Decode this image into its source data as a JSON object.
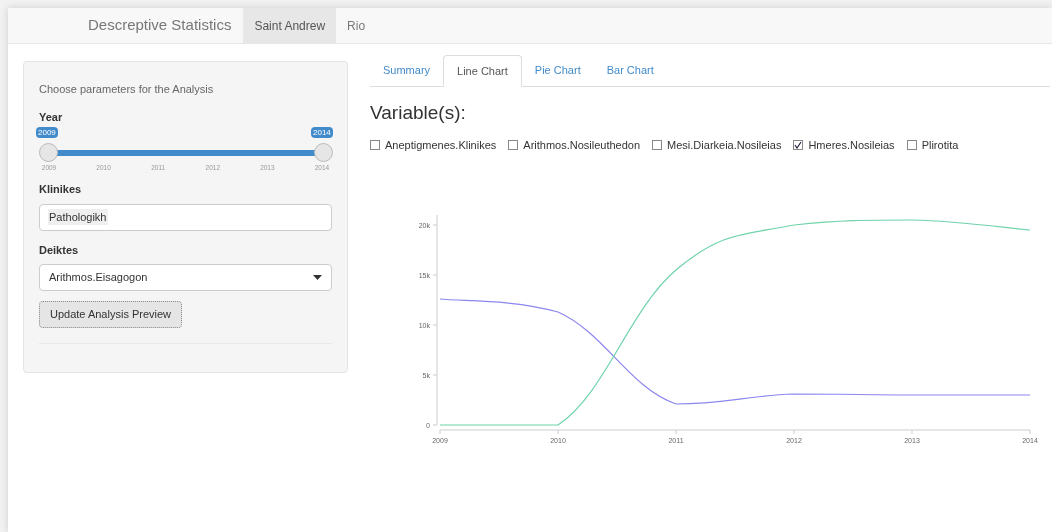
{
  "navbar": {
    "brand": "Descreptive Statistics",
    "tabs": [
      {
        "label": "Saint Andrew",
        "selected": true
      },
      {
        "label": "Rio",
        "selected": false
      }
    ]
  },
  "sidebar": {
    "heading": "Choose parameters for the Analysis",
    "year": {
      "label": "Year",
      "handles": [
        {
          "label": "2009",
          "level": 0
        },
        {
          "label": "2014",
          "level": 1
        }
      ],
      "ticks": [
        "2009",
        "2010",
        "2011",
        "2012",
        "2013",
        "2014"
      ]
    },
    "klinikes": {
      "label": "Klinikes",
      "tags": [
        "Pathologikh"
      ]
    },
    "deiktes": {
      "label": "Deiktes",
      "value": "Arithmos.Eisagogon"
    },
    "button": "Update Analysis Preview"
  },
  "main": {
    "tabs": [
      {
        "label": "Summary",
        "selected": false
      },
      {
        "label": "Line Chart",
        "selected": true
      },
      {
        "label": "Pie Chart",
        "selected": false
      },
      {
        "label": "Bar Chart",
        "selected": false
      }
    ],
    "heading": "Variable(s):",
    "variables": [
      {
        "label": "Aneptigmenes.Klinikes",
        "checked": false
      },
      {
        "label": "Arithmos.Nosileuthedon",
        "checked": false
      },
      {
        "label": "Mesi.Diarkeia.Nosileias",
        "checked": false
      },
      {
        "label": "Hmeres.Nosileias",
        "checked": true
      },
      {
        "label": "Plirotita",
        "checked": false
      }
    ],
    "chart_data": {
      "type": "line",
      "categories": [
        "2009",
        "2010",
        "2011",
        "2012",
        "2013",
        "2014"
      ],
      "series": [
        {
          "color": "#8c86ef",
          "values": [
            12600,
            11300,
            2100,
            3100,
            3000,
            3000
          ]
        },
        {
          "color": "#6fd3aa",
          "values": [
            0,
            0,
            15500,
            20000,
            20500,
            19500
          ]
        }
      ],
      "ylim": [
        0,
        21000
      ],
      "yticks": [
        {
          "value": 0,
          "label": "0"
        },
        {
          "value": 5000,
          "label": "5k"
        },
        {
          "value": 10000,
          "label": "10k"
        },
        {
          "value": 15000,
          "label": "15k"
        },
        {
          "value": 20000,
          "label": "20k"
        }
      ]
    }
  }
}
